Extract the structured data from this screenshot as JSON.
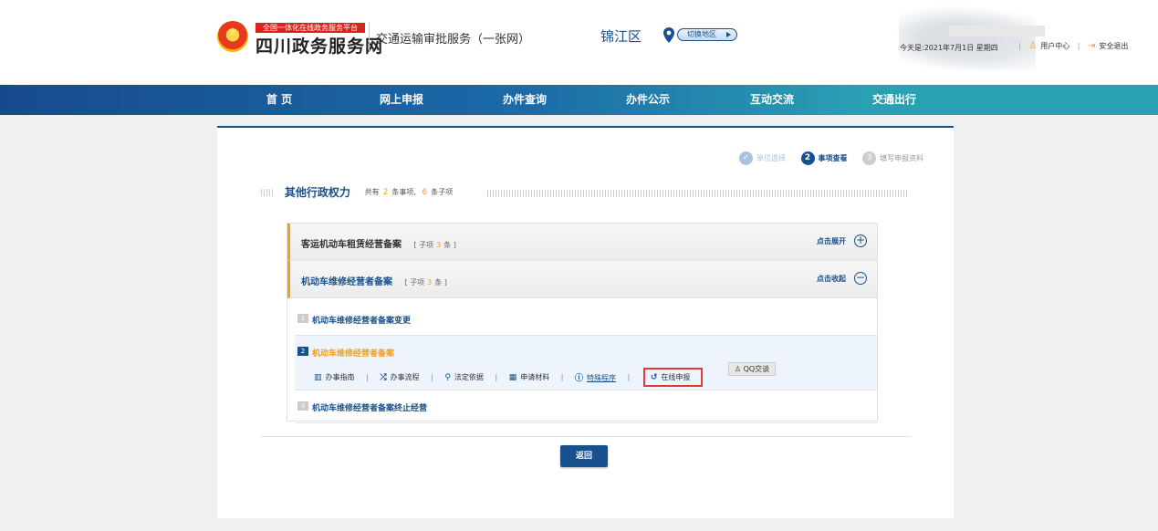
{
  "header": {
    "platform_tag": "全国一体化在线政务服务平台",
    "site_name": "四川政务服务网",
    "service_title": "交通运输审批服务（一张网）",
    "region": "锦江区",
    "switch_region": "切换地区",
    "date_text": "今天是:2021年7月1日 星期四",
    "user_center": "用户中心",
    "logout": "安全退出",
    "icons": {
      "emblem": "national-emblem-icon",
      "pin": "location-pin-icon",
      "user": "user-icon",
      "exit": "exit-icon"
    }
  },
  "nav": {
    "items": [
      "首 页",
      "网上申报",
      "办件查询",
      "办件公示",
      "互动交流",
      "交通出行"
    ]
  },
  "steps": [
    {
      "label": "单位选择",
      "state": "done",
      "mark": "✓"
    },
    {
      "label": "事项查看",
      "state": "active",
      "mark": "2"
    },
    {
      "label": "填写申报资料",
      "state": "todo",
      "mark": "3"
    }
  ],
  "section": {
    "title": "其他行政权力",
    "summary_prefix": "共有",
    "item_count": "2",
    "items_unit": "条事项,",
    "sub_count": "6",
    "sub_unit": "条子项"
  },
  "groups": [
    {
      "title": "客运机动车租赁经营备案",
      "count_prefix": "[ 子项",
      "count": "3",
      "count_suffix": "条 ]",
      "action": "点击展开",
      "toggle": "+"
    },
    {
      "title": "机动车维修经营者备案",
      "count_prefix": "[ 子项",
      "count": "3",
      "count_suffix": "条 ]",
      "action": "点击收起",
      "toggle": "−"
    }
  ],
  "sub_items": [
    {
      "num": "1",
      "title": "机动车维修经营者备案变更"
    },
    {
      "num": "2",
      "title": "机动车维修经营者备案"
    },
    {
      "num": "3",
      "title": "机动车维修经营者备案终止经营"
    }
  ],
  "operations": {
    "guide": "办事指南",
    "flow": "办事流程",
    "basis": "法定依据",
    "materials": "申请材料",
    "special": "特殊程序",
    "online": "在线申报",
    "qq": "QQ交谈",
    "separator": "|"
  },
  "footer": {
    "return_label": "返回"
  },
  "colors": {
    "primary": "#17508c",
    "accent": "#f0a020",
    "highlight": "#e53935"
  }
}
